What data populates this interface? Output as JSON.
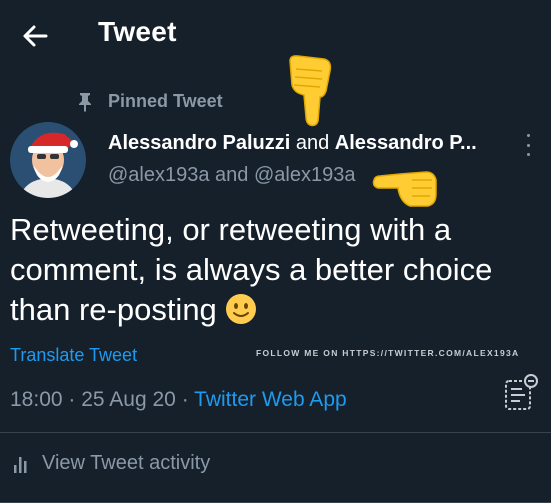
{
  "header": {
    "title": "Tweet",
    "back_icon": "arrow-left-icon"
  },
  "pinned": {
    "label": "Pinned Tweet",
    "icon": "pin-icon"
  },
  "tweet": {
    "author_name": "Alessandro Paluzzi",
    "conjunction": "and",
    "coauthor_name": "Alessandro P...",
    "author_handle": "@alex193a",
    "handles_conjunction": "and",
    "coauthor_handle": "@alex193a",
    "text": "Retweeting, or retweeting with a comment, is always a better choice than re-posting",
    "emoji": "slightly-smiling-face",
    "translate_label": "Translate Tweet",
    "time": "18:00",
    "date": "25 Aug 20",
    "source": "Twitter Web App",
    "separator": "·"
  },
  "watermark": "FOLLOW ME ON HTTPS://TWITTER.COM/ALEX193A",
  "activity": {
    "label": "View Tweet activity",
    "icon": "bar-chart-icon"
  },
  "colors": {
    "background": "#15202b",
    "accent": "#1d9bf0",
    "muted": "#8b98a5",
    "divider": "#38444d"
  }
}
